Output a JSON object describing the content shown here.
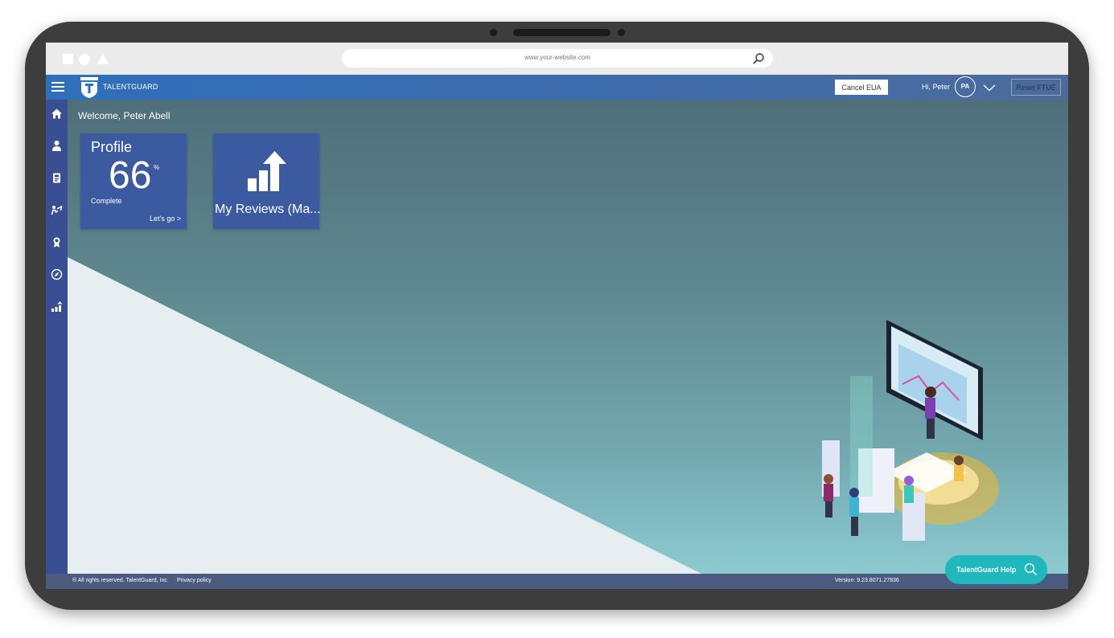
{
  "browser": {
    "url": "www.your-website.com"
  },
  "header": {
    "brand": "TALENTGUARD",
    "cancel_label": "Cancel EUA",
    "greeting": "Hi, Peter",
    "avatar_initials": "PA",
    "reset_label": "Reset FTUE"
  },
  "sidebar": {
    "items": [
      {
        "icon": "home-icon"
      },
      {
        "icon": "person-icon"
      },
      {
        "icon": "id-card-icon"
      },
      {
        "icon": "career-path-icon"
      },
      {
        "icon": "award-icon"
      },
      {
        "icon": "compass-icon"
      },
      {
        "icon": "bar-chart-up-icon"
      }
    ]
  },
  "main": {
    "welcome": "Welcome, Peter Abell",
    "profile_tile": {
      "title": "Profile",
      "percent": "66",
      "percent_sign": "%",
      "status": "Complete",
      "cta": "Let's go >"
    },
    "reviews_tile": {
      "label": "My Reviews (Ma..."
    }
  },
  "footer": {
    "copyright": "® All rights reserved. TalentGuard, Inc",
    "privacy": "Privacy policy",
    "version": "Version: 9.23.8071.27836"
  },
  "help": {
    "label": "TalentGuard Help"
  },
  "colors": {
    "header": "#3d6cab",
    "sidebar": "#3a4f93",
    "tile": "#3c5aa0",
    "help": "#1fb8bd",
    "footer": "#4a5b7f"
  }
}
